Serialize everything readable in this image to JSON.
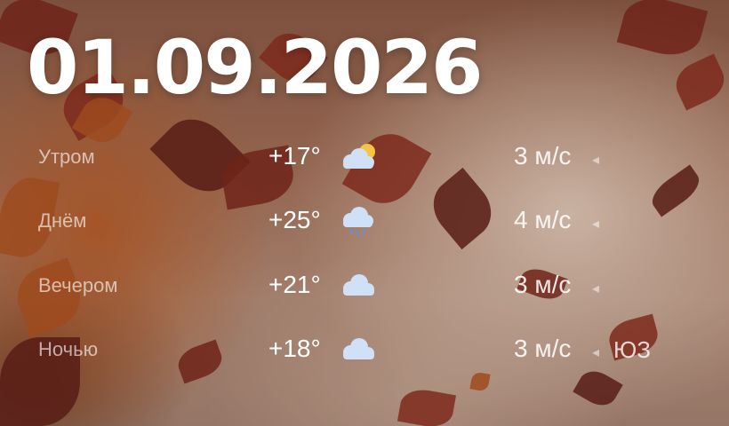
{
  "date": "01.09.2026",
  "forecast": [
    {
      "period": "Утром",
      "temp": "+17°",
      "icon": "partly-cloudy-icon",
      "wind": "3 м/с",
      "direction": ""
    },
    {
      "period": "Днём",
      "temp": "+25°",
      "icon": "cloud-rain-icon",
      "wind": "4 м/с",
      "direction": ""
    },
    {
      "period": "Вечером",
      "temp": "+21°",
      "icon": "cloud-icon",
      "wind": "3 м/с",
      "direction": ""
    },
    {
      "period": "Ночью",
      "temp": "+18°",
      "icon": "cloud-icon",
      "wind": "3 м/с",
      "direction": "ЮЗ"
    }
  ],
  "colors": {
    "text": "#ffffff",
    "cloud": "#cfe0f7",
    "sun": "#f6c343",
    "rain": "#6e8fc0"
  }
}
